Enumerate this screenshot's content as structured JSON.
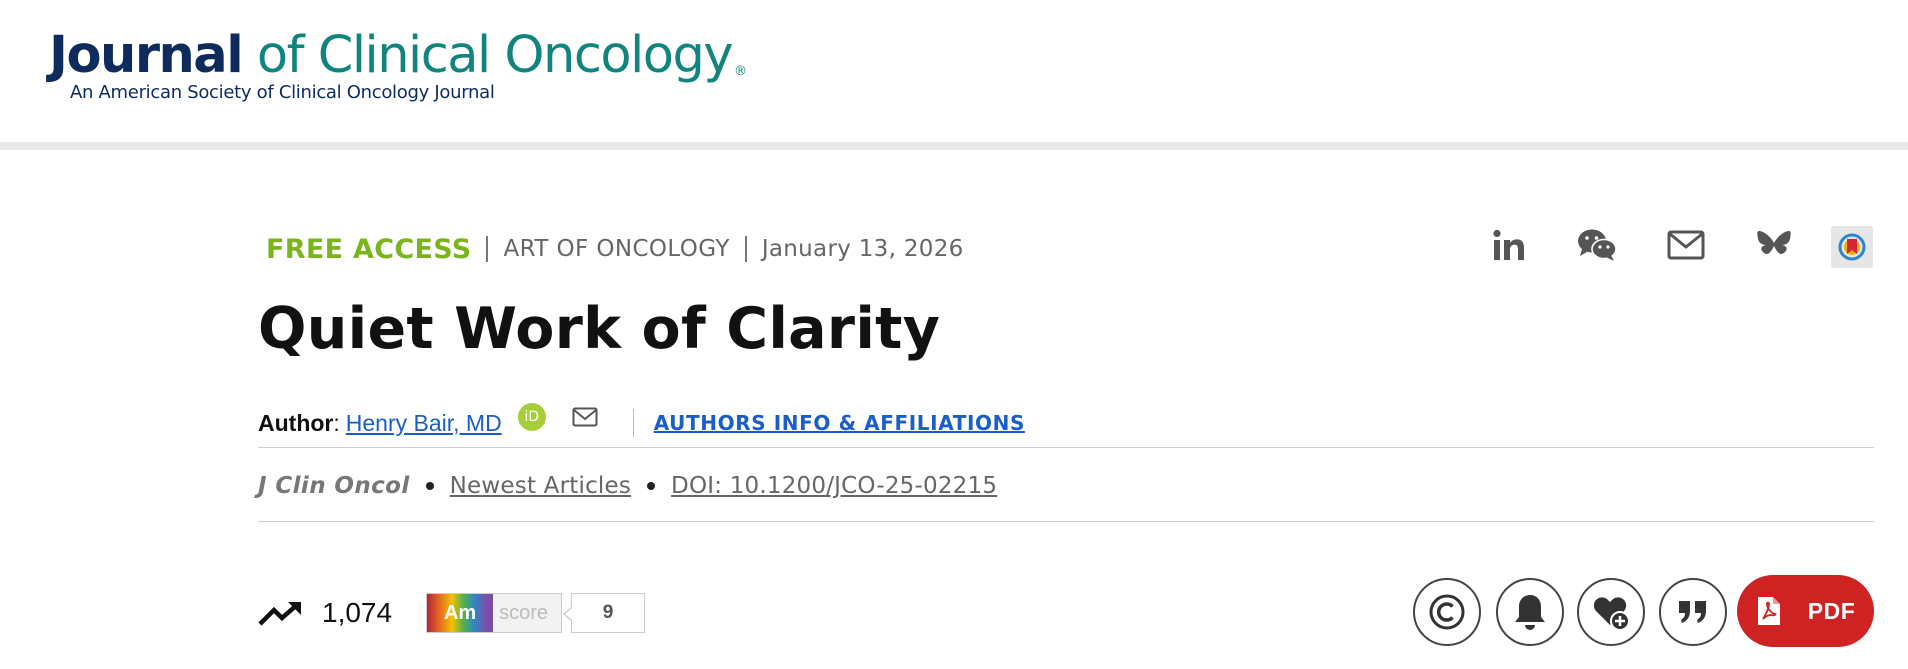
{
  "header": {
    "logo_journal": "Journal",
    "logo_rest": " of Clinical Oncology",
    "logo_reg": "®",
    "logo_subtitle": "An American Society of Clinical Oncology Journal",
    "colors": {
      "navy": "#0d2b5c",
      "teal": "#11857d"
    }
  },
  "article_meta": {
    "access": "FREE ACCESS",
    "section": "ART OF ONCOLOGY",
    "date": "January 13, 2026",
    "colors": {
      "access_green": "#7ab51d"
    }
  },
  "share_icons": [
    "linkedin-icon",
    "wechat-icon",
    "mail-icon",
    "bluesky-icon",
    "mendeley-icon"
  ],
  "title": "Quiet Work of Clarity",
  "authors": {
    "label": "Author",
    "colon": ":",
    "name": "Henry Bair, MD",
    "orcid_label": "iD",
    "affiliations_link": "AUTHORS INFO & AFFILIATIONS",
    "link_color": "#1a5ec7"
  },
  "citation": {
    "journal": "J Clin Oncol",
    "issue": "Newest Articles",
    "doi": "DOI: 10.1200/JCO-25-02215"
  },
  "metrics": {
    "views": "1,074",
    "altmetric_badge": "Am",
    "altmetric_label": "score",
    "altmetric_score": "9"
  },
  "tools": {
    "items": [
      "copyright-icon",
      "bell-icon",
      "heart-add-icon",
      "quote-icon"
    ],
    "pdf_label": "PDF",
    "pdf_color": "#cf2222"
  }
}
